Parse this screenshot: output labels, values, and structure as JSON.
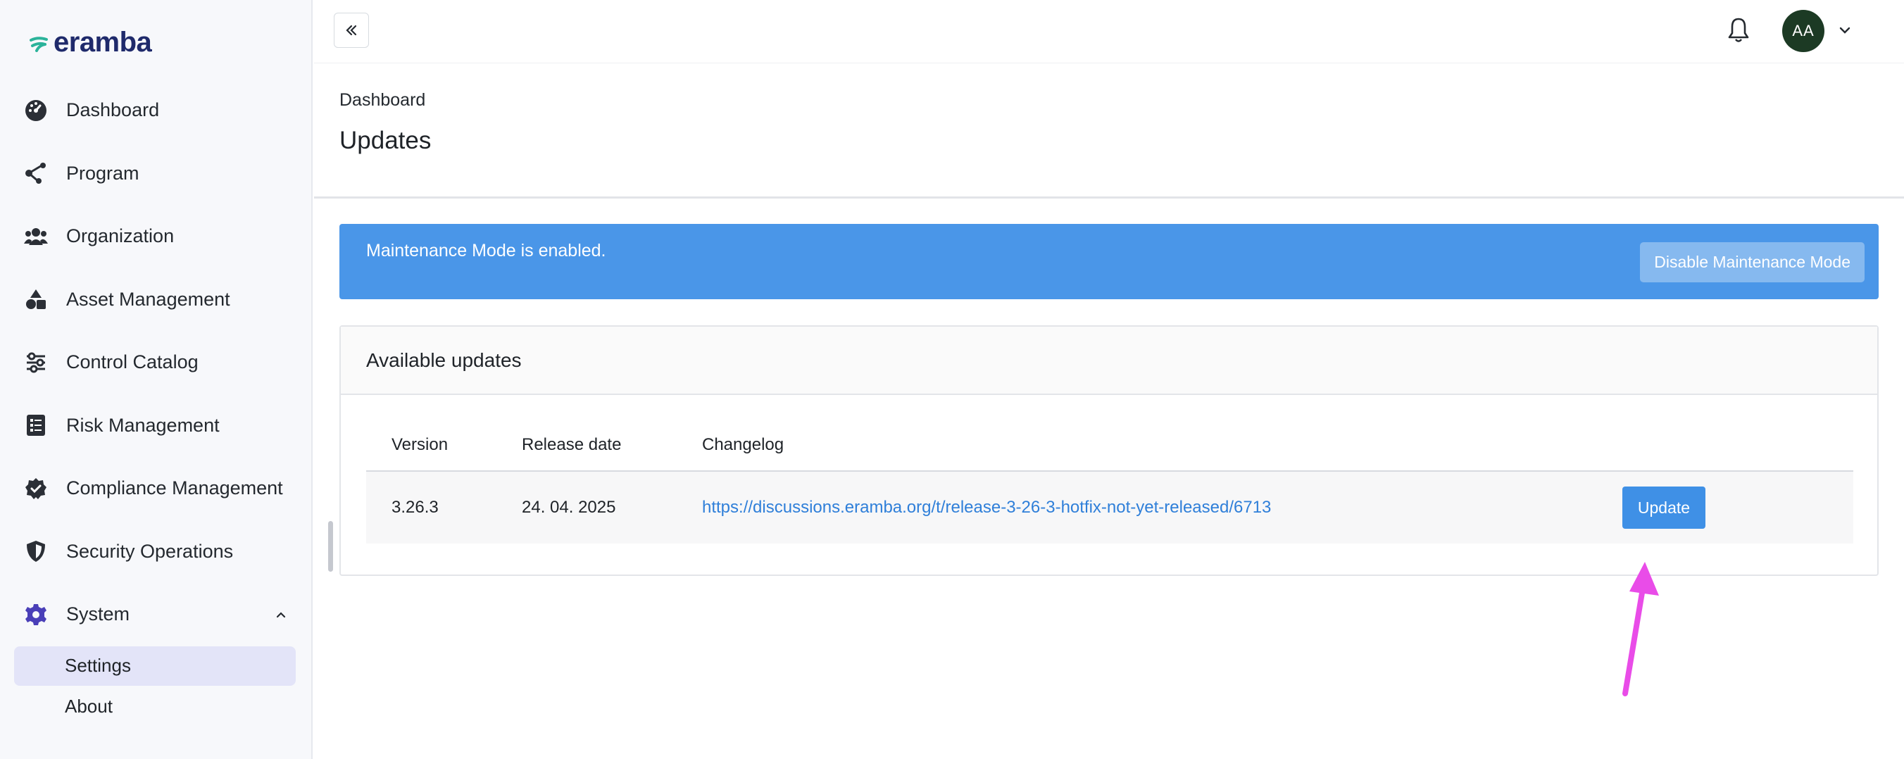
{
  "app": {
    "logo_text": "eramba",
    "brand_color": "#2a9d8f"
  },
  "sidebar": {
    "items": [
      {
        "label": "Dashboard",
        "icon": "gauge-icon"
      },
      {
        "label": "Program",
        "icon": "share-nodes-icon"
      },
      {
        "label": "Organization",
        "icon": "users-icon"
      },
      {
        "label": "Asset Management",
        "icon": "shapes-icon"
      },
      {
        "label": "Control Catalog",
        "icon": "sliders-icon"
      },
      {
        "label": "Risk Management",
        "icon": "list-check-icon"
      },
      {
        "label": "Compliance Management",
        "icon": "badge-check-icon"
      },
      {
        "label": "Security Operations",
        "icon": "shield-icon"
      },
      {
        "label": "System",
        "icon": "gear-icon",
        "expanded": true
      }
    ],
    "system_children": [
      {
        "label": "Settings",
        "active": true
      },
      {
        "label": "About",
        "active": false
      }
    ]
  },
  "topbar": {
    "avatar_initials": "AA"
  },
  "page": {
    "breadcrumb": "Dashboard",
    "title": "Updates"
  },
  "alert": {
    "message": "Maintenance Mode is enabled.",
    "button_label": "Disable Maintenance Mode",
    "color": "#4a96e8"
  },
  "updates_card": {
    "title": "Available updates",
    "columns": [
      "Version",
      "Release date",
      "Changelog"
    ],
    "rows": [
      {
        "version": "3.26.3",
        "release_date": "24. 04. 2025",
        "changelog": "https://discussions.eramba.org/t/release-3-26-3-hotfix-not-yet-released/6713",
        "action_label": "Update"
      }
    ]
  },
  "annotation": {
    "arrow_color": "#e94ce8"
  }
}
